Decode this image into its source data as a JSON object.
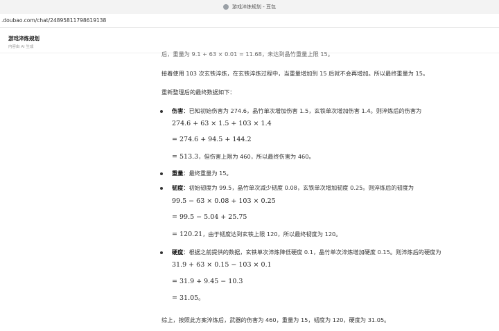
{
  "browser": {
    "tab_title": "游戏淬炼规划 - 豆包",
    "url": ".doubao.com/chat/24895811798619138"
  },
  "app": {
    "title": "游戏淬炼规划",
    "subtitle": "内容由 AI 生成"
  },
  "message": {
    "cut_line": "后，重量为 9.1 + 63 × 0.01 = 11.68，未达到晶竹重量上限 15。",
    "para1": "接着使用 103 次玄铁淬炼，在玄铁淬炼过程中，当重量增加到 15 后就不会再增加。所以最终重量为 15。",
    "para2": "重新整理后的最终数据如下：",
    "damage": {
      "label": "伤害",
      "text": "：已知初始伤害为 274.6，晶竹单次增加伤害 1.5，玄铁单次增加伤害 1.4。则淬炼后的伤害为",
      "eq1": "274.6 + 63 × 1.5 + 103 × 1.4",
      "eq2": "= 274.6 + 94.5 + 144.2",
      "eq3": "= 513.3",
      "eq3_tail": "，但伤害上限为 460，所以最终伤害为 460。"
    },
    "weight": {
      "label": "重量",
      "text": "：最终重量为 15。"
    },
    "toughness": {
      "label": "韧度",
      "text": "：初始韧度为 99.5，晶竹单次减少韧度 0.08，玄铁单次增加韧度 0.25。则淬炼后的韧度为",
      "eq1": "99.5 − 63 × 0.08 + 103 × 0.25",
      "eq2": "= 99.5 − 5.04 + 25.75",
      "eq3": "= 120.21",
      "eq3_tail": "，由于韧度达到玄铁上限 120，所以最终韧度为 120。"
    },
    "hardness": {
      "label": "硬度",
      "text": "：根据之前提供的数据，玄铁单次淬炼降低硬度 0.1，晶竹单次淬炼增加硬度 0.15。则淬炼后的硬度为",
      "eq1": "31.9 + 63 × 0.15 − 103 × 0.1",
      "eq2": "= 31.9 + 9.45 − 10.3",
      "eq3": "= 31.05",
      "eq3_tail": "。"
    },
    "summary": "综上，按照此方案淬炼后，武器的伤害为 460，重量为 15，韧度为 120，硬度为 31.05。"
  }
}
